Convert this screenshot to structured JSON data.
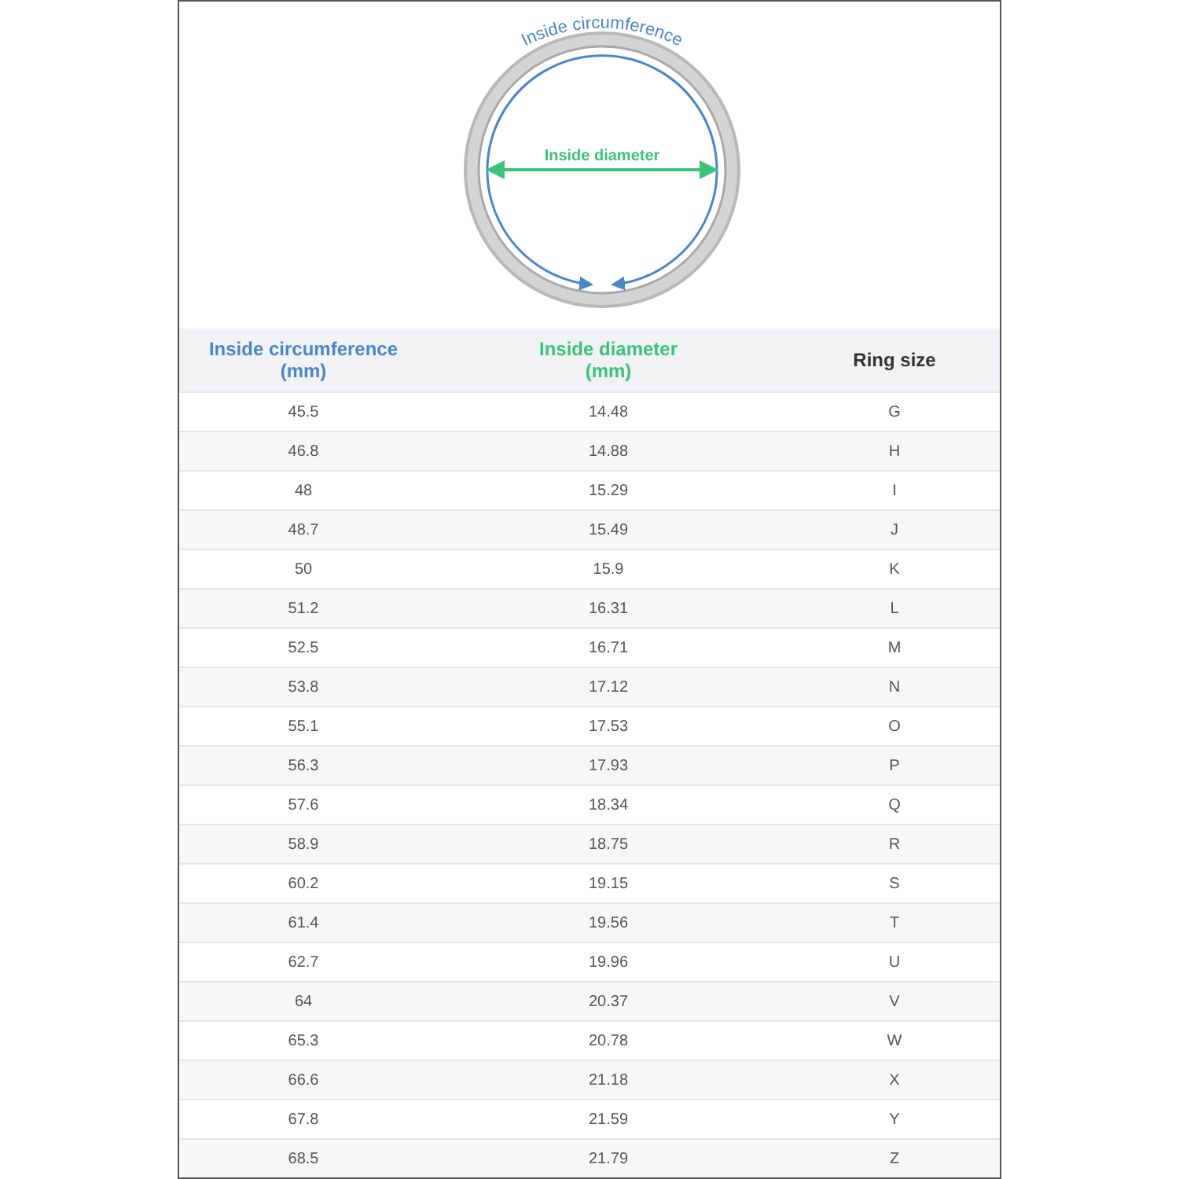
{
  "diagram": {
    "circumference_label": "Inside circumference",
    "diameter_label": "Inside diameter"
  },
  "table": {
    "columns": [
      {
        "label": "Inside circumference",
        "unit": "(mm)",
        "color": "#4a86c8"
      },
      {
        "label": "Inside diameter",
        "unit": "(mm)",
        "color": "#3cc27a"
      },
      {
        "label": "Ring size",
        "color": "#333333"
      }
    ],
    "rows": [
      [
        "45.5",
        "14.48",
        "G"
      ],
      [
        "46.8",
        "14.88",
        "H"
      ],
      [
        "48",
        "15.29",
        "I"
      ],
      [
        "48.7",
        "15.49",
        "J"
      ],
      [
        "50",
        "15.9",
        "K"
      ],
      [
        "51.2",
        "16.31",
        "L"
      ],
      [
        "52.5",
        "16.71",
        "M"
      ],
      [
        "53.8",
        "17.12",
        "N"
      ],
      [
        "55.1",
        "17.53",
        "O"
      ],
      [
        "56.3",
        "17.93",
        "P"
      ],
      [
        "57.6",
        "18.34",
        "Q"
      ],
      [
        "58.9",
        "18.75",
        "R"
      ],
      [
        "60.2",
        "19.15",
        "S"
      ],
      [
        "61.4",
        "19.56",
        "T"
      ],
      [
        "62.7",
        "19.96",
        "U"
      ],
      [
        "64",
        "20.37",
        "V"
      ],
      [
        "65.3",
        "20.78",
        "W"
      ],
      [
        "66.6",
        "21.18",
        "X"
      ],
      [
        "67.8",
        "21.59",
        "Y"
      ],
      [
        "68.5",
        "21.79",
        "Z"
      ]
    ]
  }
}
